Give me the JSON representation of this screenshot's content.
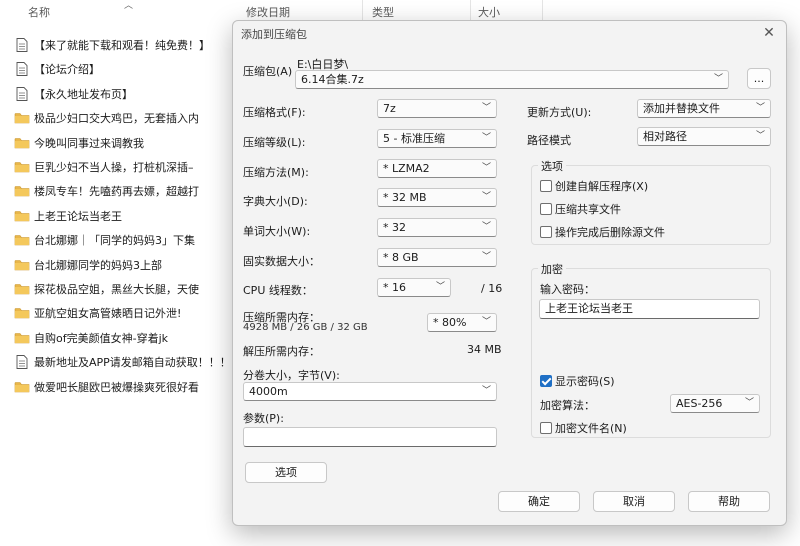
{
  "explorer": {
    "columns": {
      "name": "名称",
      "modified": "修改日期",
      "type": "类型",
      "size": "大小"
    },
    "files": [
      {
        "name": "【来了就能下载和观看！纯免费！】",
        "kind": "doc"
      },
      {
        "name": "【论坛介绍】",
        "kind": "doc"
      },
      {
        "name": "【永久地址发布页】",
        "kind": "doc"
      },
      {
        "name": "极品少妇口交大鸡巴，无套插入内",
        "kind": "folder"
      },
      {
        "name": "今晚叫同事过来调教我",
        "kind": "folder"
      },
      {
        "name": "巨乳少妇不当人操，打桩机深插–",
        "kind": "folder"
      },
      {
        "name": "楼凤专车！先嗑药再去嫖，超越打",
        "kind": "folder"
      },
      {
        "name": "上老王论坛当老王",
        "kind": "folder"
      },
      {
        "name": "台北娜娜｜「同学的妈妈3」下集",
        "kind": "folder"
      },
      {
        "name": "台北娜娜同学的妈妈3上部",
        "kind": "folder"
      },
      {
        "name": "探花极品空姐，黑丝大长腿，天使",
        "kind": "folder"
      },
      {
        "name": "亚航空姐女高管婊晒日记外泄!",
        "kind": "folder"
      },
      {
        "name": "自购of完美颜值女神-穿着jk",
        "kind": "folder"
      },
      {
        "name": "最新地址及APP请发邮箱自动获取！！！",
        "kind": "doc"
      },
      {
        "name": "做爱吧长腿欧巴被爆操爽死很好看",
        "kind": "folder"
      }
    ]
  },
  "dialog": {
    "title": "添加到压缩包",
    "archive_label": "压缩包(A)",
    "archive_path": "E:\\白日梦\\",
    "archive_name": "6.14合集.7z",
    "browse_label": "...",
    "left_fields": {
      "format": {
        "label": "压缩格式(F):",
        "value": "7z"
      },
      "level": {
        "label": "压缩等级(L):",
        "value": "5 - 标准压缩"
      },
      "method": {
        "label": "压缩方法(M):",
        "value": "* LZMA2"
      },
      "dict": {
        "label": "字典大小(D):",
        "value": "* 32 MB"
      },
      "word": {
        "label": "单词大小(W):",
        "value": "* 32"
      },
      "solid": {
        "label": "固实数据大小：",
        "value": "* 8 GB"
      },
      "threads": {
        "label": "CPU 线程数：",
        "value": "* 16",
        "total": "/ 16"
      },
      "mem_compress": {
        "label": "压缩所需内存：",
        "detail": "4928 MB / 26 GB / 32 GB",
        "value": "* 80%"
      },
      "mem_decompress": {
        "label": "解压所需内存：",
        "value": "34 MB"
      },
      "volume": {
        "label": "分卷大小，字节(V):",
        "value": "4000m"
      },
      "params": {
        "label": "参数(P):",
        "value": ""
      }
    },
    "options_button": "选项",
    "right_fields": {
      "update_mode": {
        "label": "更新方式(U):",
        "value": "添加并替换文件"
      },
      "path_mode": {
        "label": "路径模式",
        "value": "相对路径"
      }
    },
    "options_group": {
      "title": "选项",
      "items": [
        {
          "label": "创建自解压程序(X)",
          "checked": false
        },
        {
          "label": "压缩共享文件",
          "checked": false
        },
        {
          "label": "操作完成后删除源文件",
          "checked": false
        }
      ]
    },
    "encryption": {
      "title": "加密",
      "password_label": "输入密码：",
      "password_value": "上老王论坛当老王",
      "show_password": {
        "label": "显示密码(S)",
        "checked": true
      },
      "method_label": "加密算法：",
      "method_value": "AES-256",
      "encrypt_names": {
        "label": "加密文件名(N)",
        "checked": false
      }
    },
    "buttons": {
      "ok": "确定",
      "cancel": "取消",
      "help": "帮助"
    }
  },
  "colors": {
    "accent": "#1f6fc5",
    "folder": "#e8b64a",
    "dialog_bg": "#f3f3f3"
  },
  "icons": {
    "folder": "folder-icon",
    "document": "document-icon",
    "close": "close-icon",
    "dropdown": "chevron-down-icon"
  }
}
